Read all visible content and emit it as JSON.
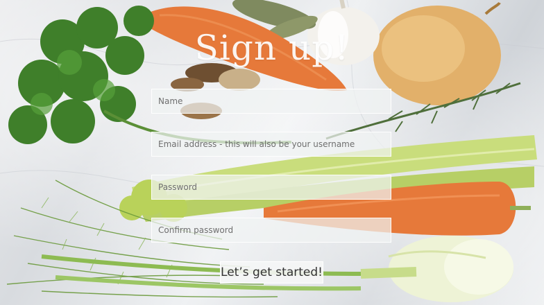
{
  "form": {
    "title": "Sign up!",
    "name_placeholder": "Name",
    "email_placeholder": "Email address - this will also be your username",
    "password_placeholder": "Password",
    "confirm_placeholder": "Confirm password",
    "submit_label": "Let’s get started!"
  },
  "colors": {
    "marble": "#e3e5e8",
    "carrot": "#e6793a",
    "parsley": "#3f7f2a",
    "celery": "#c9dd7c",
    "fennel": "#eef3d6",
    "onion": "#d9a45b",
    "garlic": "#f2efe8"
  }
}
